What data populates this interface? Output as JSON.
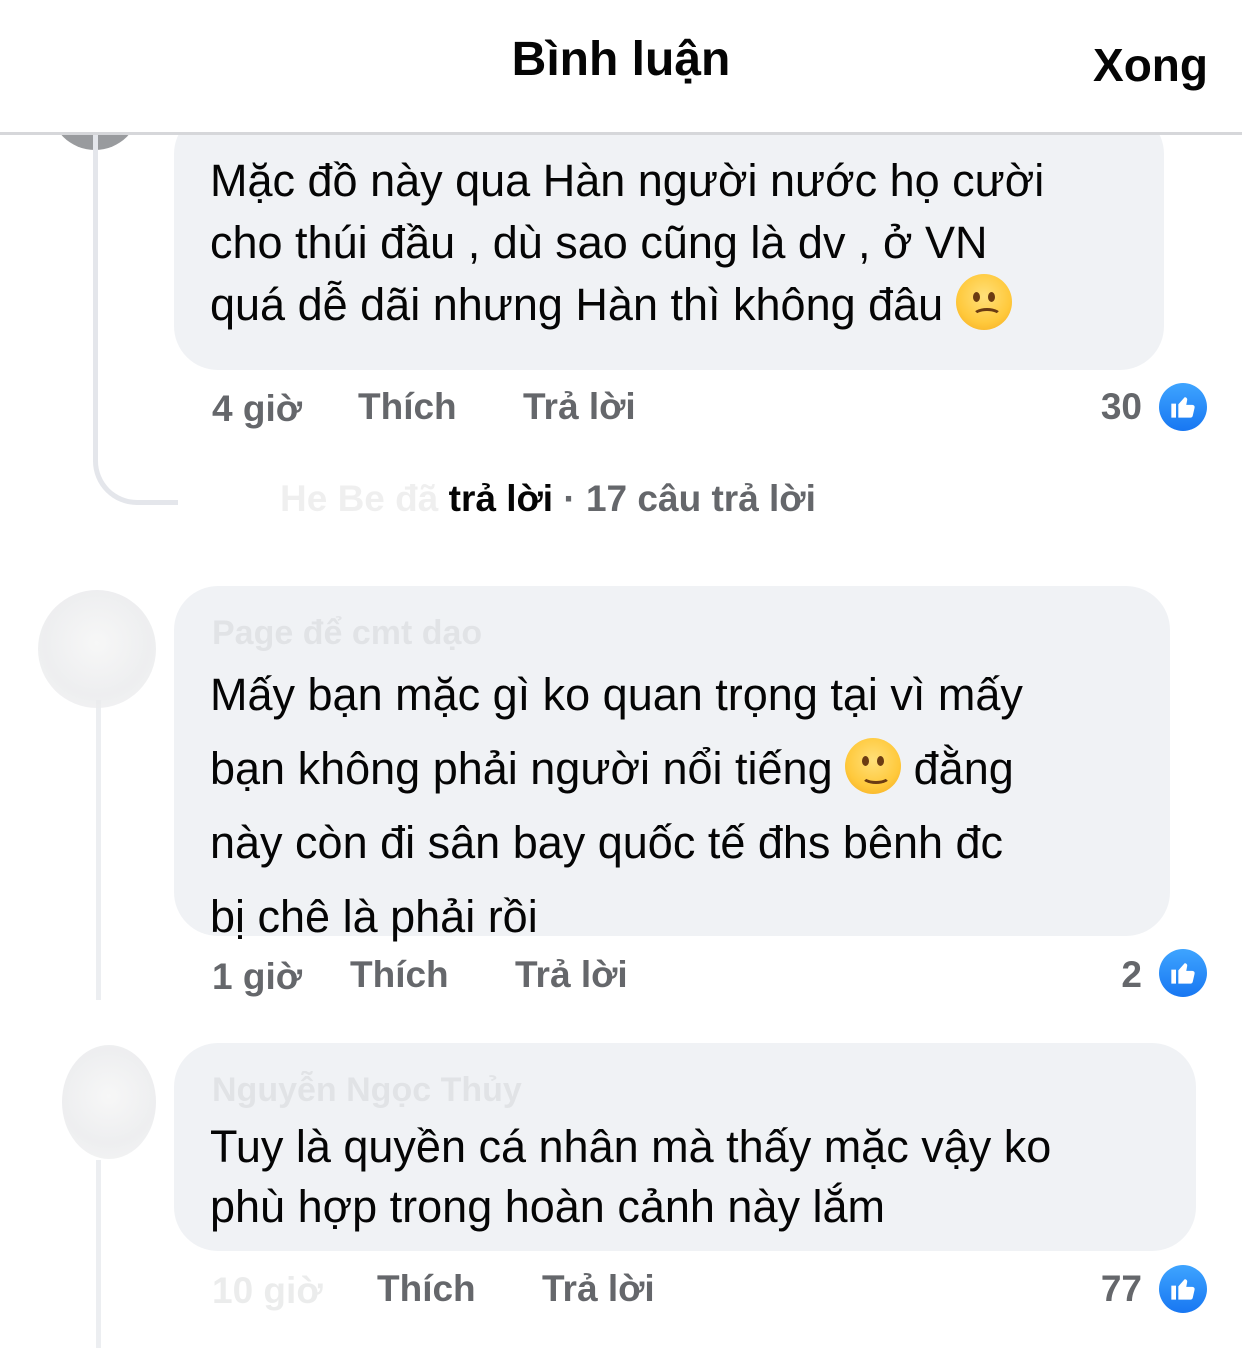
{
  "header": {
    "title": "Bình luận",
    "done_label": "Xong"
  },
  "comments": [
    {
      "author": "",
      "text_lines": [
        "Mặc đồ này qua Hàn người nước họ cười",
        "cho thúi đầu , dù sao cũng là dv , ở VN",
        "quá dễ dãi nhưng Hàn thì không đâu"
      ],
      "emoji": "frowning-face",
      "time": "4 giờ",
      "like_label": "Thích",
      "reply_label": "Trả lời",
      "like_count": "30",
      "replies": {
        "replier": "He Be",
        "verb_prefix": "đã",
        "verb": "trả lời",
        "count_text": "· 17 câu trả lời"
      }
    },
    {
      "author": "Page để cmt dạo",
      "text_lines": [
        "Mấy bạn mặc gì ko quan trọng tại vì mấy",
        "bạn không phải người nổi tiếng",
        "đằng",
        "này còn đi sân bay quốc tế đhs bênh đc",
        "bị chê là phải rồi"
      ],
      "emoji": "slightly-smiling-face",
      "time": "1 giờ",
      "like_label": "Thích",
      "reply_label": "Trả lời",
      "like_count": "2"
    },
    {
      "author": "Nguyễn Ngọc Thủy",
      "text_lines": [
        "Tuy là quyền cá nhân mà thấy mặc vậy ko",
        "phù hợp trong hoàn cảnh này lắm"
      ],
      "time": "10 giờ",
      "like_label": "Thích",
      "reply_label": "Trả lời",
      "like_count": "77"
    }
  ],
  "colors": {
    "bubble": "#f0f2f5",
    "meta_text": "#65676b",
    "like_blue": "#1877f2"
  }
}
